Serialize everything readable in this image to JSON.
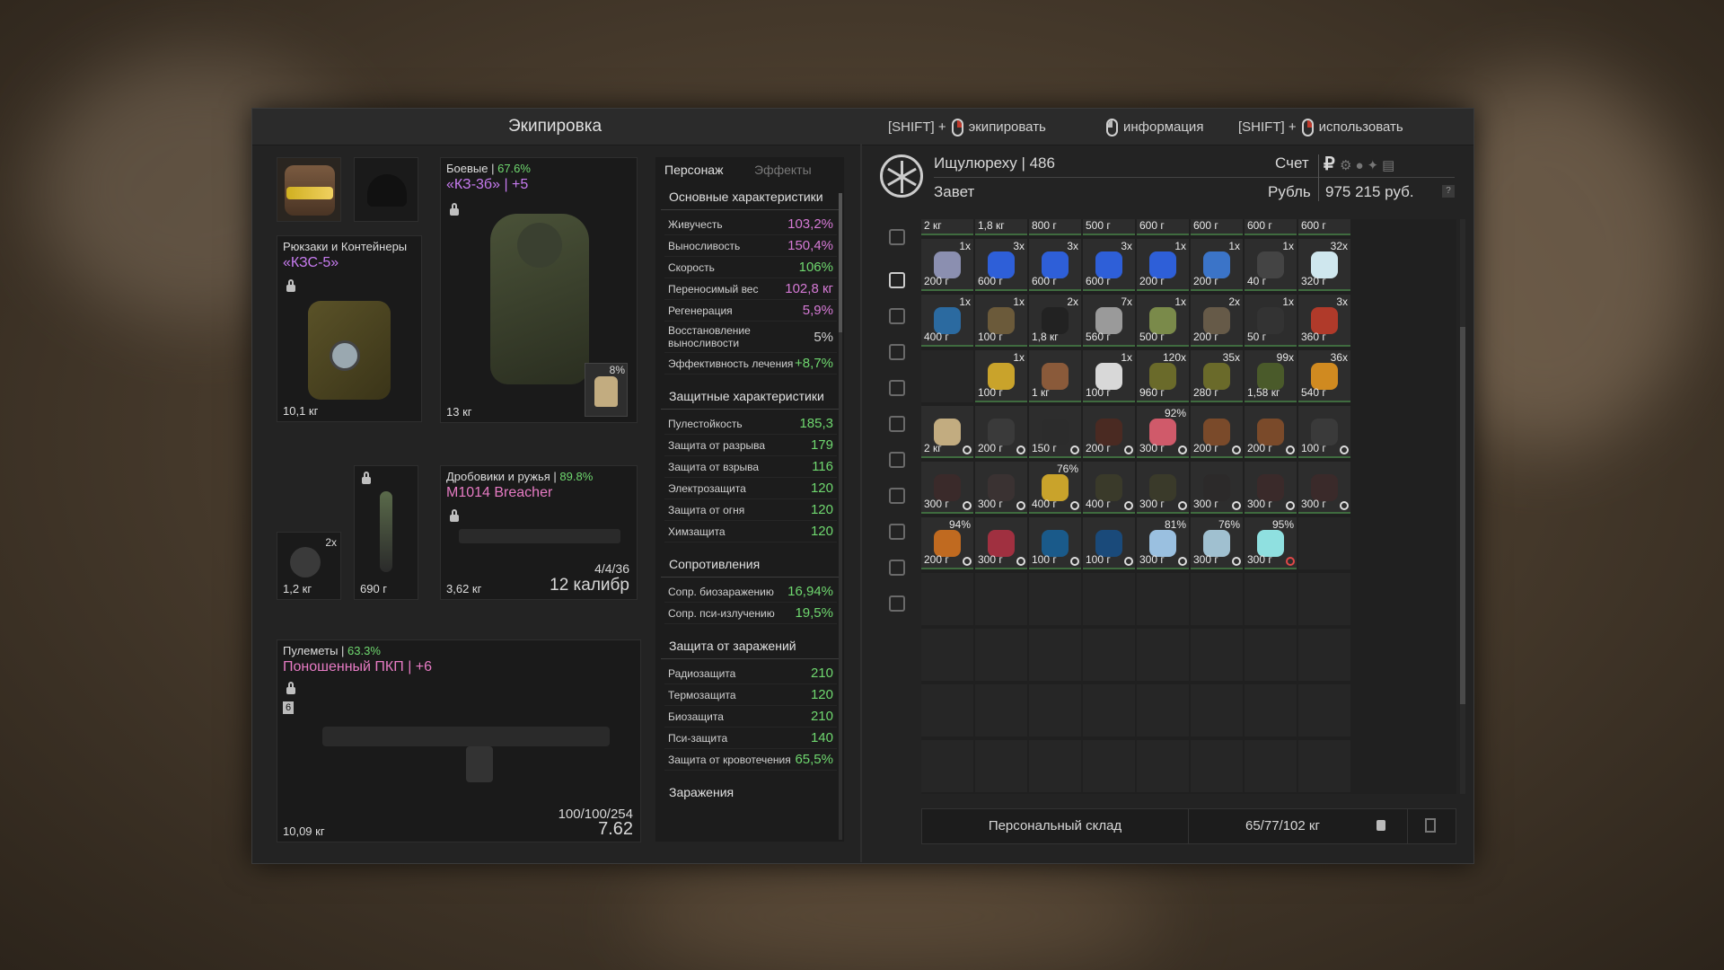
{
  "window": {
    "title": "Экипировка"
  },
  "hints": [
    {
      "prefix": "[SHIFT] +",
      "action": "экипировать"
    },
    {
      "prefix": "",
      "action": "информация"
    },
    {
      "prefix": "[SHIFT] +",
      "action": "использовать"
    }
  ],
  "equipment": {
    "armor": {
      "label": "Боевые",
      "pct": "67.6%",
      "name": "«КЗ-3б» | +5",
      "weight": "13 кг",
      "badge": "8%"
    },
    "backpack": {
      "label": "Рюкзаки и Контейнеры",
      "name": "«КЗС-5»",
      "weight": "10,1 кг"
    },
    "slot_small1": {
      "qty": "2x",
      "weight": "1,2 кг"
    },
    "slot_small2": {
      "weight": "690 г"
    },
    "shotgun": {
      "label": "Дробовики и ружья",
      "pct": "89.8%",
      "name": "M1014 Breacher",
      "weight": "3,62 кг",
      "ammo": "4/4/36",
      "caliber": "12 калибр"
    },
    "mg": {
      "label": "Пулеметы",
      "pct": "63.3%",
      "name": "Поношенный ПКП | +6",
      "weight": "10,09 кг",
      "ammo": "100/100/254",
      "caliber": "7.62",
      "slot_num": "6"
    }
  },
  "stats": {
    "tabs": [
      "Персонаж",
      "Эффекты"
    ],
    "main_title": "Основные характеристики",
    "main": [
      {
        "k": "Живучесть",
        "v": "103,2%",
        "c": "p"
      },
      {
        "k": "Выносливость",
        "v": "150,4%",
        "c": "p"
      },
      {
        "k": "Скорость",
        "v": "106%",
        "c": "g"
      },
      {
        "k": "Переносимый вес",
        "v": "102,8 кг",
        "c": "p"
      },
      {
        "k": "Регенерация",
        "v": "5,9%",
        "c": "p"
      },
      {
        "k": "Восстановление выносливости",
        "v": "5%",
        "c": ""
      },
      {
        "k": "Эффективность лечения",
        "v": "+8,7%",
        "c": "g"
      }
    ],
    "prot_title": "Защитные характеристики",
    "prot": [
      {
        "k": "Пулестойкость",
        "v": "185,3",
        "c": "g"
      },
      {
        "k": "Защита от разрыва",
        "v": "179",
        "c": "g"
      },
      {
        "k": "Защита от взрыва",
        "v": "116",
        "c": "g"
      },
      {
        "k": "Электрозащита",
        "v": "120",
        "c": "g"
      },
      {
        "k": "Защита от огня",
        "v": "120",
        "c": "g"
      },
      {
        "k": "Химзащита",
        "v": "120",
        "c": "g"
      }
    ],
    "res_title": "Сопротивления",
    "res": [
      {
        "k": "Сопр. биозаражению",
        "v": "16,94%",
        "c": "g"
      },
      {
        "k": "Сопр. пси-излучению",
        "v": "19,5%",
        "c": "g"
      }
    ],
    "inf_title": "Защита от заражений",
    "inf": [
      {
        "k": "Радиозащита",
        "v": "210",
        "c": "g"
      },
      {
        "k": "Термозащита",
        "v": "120",
        "c": "g"
      },
      {
        "k": "Биозащита",
        "v": "210",
        "c": "g"
      },
      {
        "k": "Пси-защита",
        "v": "140",
        "c": "g"
      },
      {
        "k": "Защита от кровотечения",
        "v": "65,5%",
        "c": "g"
      }
    ],
    "last_title": "Заражения"
  },
  "player": {
    "name": "Ищулюреху | 486",
    "faction": "Завет",
    "account_label": "Счет",
    "currency": "Рубль",
    "balance": "975 215 руб."
  },
  "inventory": {
    "top_row": [
      "2 кг",
      "1,8 кг",
      "800 г",
      "500 г",
      "600 г",
      "600 г",
      "600 г",
      "600 г"
    ],
    "items": [
      {
        "q": "1x",
        "p": "200 г",
        "c": "#8b8fb0"
      },
      {
        "q": "3x",
        "p": "600 г",
        "c": "#2e5fd8"
      },
      {
        "q": "3x",
        "p": "600 г",
        "c": "#2e5fd8"
      },
      {
        "q": "3x",
        "p": "600 г",
        "c": "#2e5fd8"
      },
      {
        "q": "1x",
        "p": "200 г",
        "c": "#2e5fd8"
      },
      {
        "q": "1x",
        "p": "200 г",
        "c": "#3b74c8"
      },
      {
        "q": "1x",
        "p": "40 г",
        "c": "#444"
      },
      {
        "q": "32x",
        "p": "320 г",
        "c": "#cfe7ee"
      },
      {
        "q": "1x",
        "p": "400 г",
        "c": "#2b6aa0"
      },
      {
        "q": "1x",
        "p": "100 г",
        "c": "#6b5a3a"
      },
      {
        "q": "2x",
        "p": "1,8 кг",
        "c": "#222"
      },
      {
        "q": "7x",
        "p": "560 г",
        "c": "#9a9a9a"
      },
      {
        "q": "1x",
        "p": "500 г",
        "c": "#7a8a4a"
      },
      {
        "q": "2x",
        "p": "200 г",
        "c": "#665a48"
      },
      {
        "q": "1x",
        "p": "50 г",
        "c": "#333"
      },
      {
        "q": "3x",
        "p": "360 г",
        "c": "#b03a2a"
      },
      {
        "q": "",
        "p": "",
        "c": ""
      },
      {
        "q": "1x",
        "p": "100 г",
        "c": "#c9a32b"
      },
      {
        "q": "",
        "p": "1 кг",
        "c": "#8a5a3a"
      },
      {
        "q": "1x",
        "p": "100 г",
        "c": "#d8d8d8"
      },
      {
        "q": "120x",
        "p": "960 г",
        "c": "#6a6a2a"
      },
      {
        "q": "35x",
        "p": "280 г",
        "c": "#6a6a2a"
      },
      {
        "q": "99x",
        "p": "1,58 кг",
        "c": "#4a5a2a"
      },
      {
        "q": "36x",
        "p": "540 г",
        "c": "#d08a20"
      },
      {
        "q": "",
        "p": "2 кг",
        "c": "#c2ac80"
      },
      {
        "q": "",
        "p": "200 г",
        "c": "#3a3a3a"
      },
      {
        "q": "",
        "p": "150 г",
        "c": "#2c2c2c"
      },
      {
        "q": "",
        "p": "200 г",
        "c": "#4a2a22"
      },
      {
        "q": "92%",
        "p": "300 г",
        "c": "#d05a6a"
      },
      {
        "q": "",
        "p": "200 г",
        "c": "#7a4a2a"
      },
      {
        "q": "",
        "p": "200 г",
        "c": "#7a4a2a"
      },
      {
        "q": "",
        "p": "100 г",
        "c": "#3a3a3a"
      },
      {
        "q": "",
        "p": "300 г",
        "c": "#3a2a2a"
      },
      {
        "q": "",
        "p": "300 г",
        "c": "#3a3232"
      },
      {
        "q": "76%",
        "p": "400 г",
        "c": "#c9a32b"
      },
      {
        "q": "",
        "p": "400 г",
        "c": "#3a3a2a"
      },
      {
        "q": "",
        "p": "300 г",
        "c": "#3a3a2a"
      },
      {
        "q": "",
        "p": "300 г",
        "c": "#2c2a2a"
      },
      {
        "q": "",
        "p": "300 г",
        "c": "#3a2a2a"
      },
      {
        "q": "",
        "p": "300 г",
        "c": "#3a2a2a"
      },
      {
        "q": "94%",
        "p": "200 г",
        "c": "#c06a20"
      },
      {
        "q": "",
        "p": "300 г",
        "c": "#a03040"
      },
      {
        "q": "",
        "p": "100 г",
        "c": "#1a5a8a"
      },
      {
        "q": "",
        "p": "100 г",
        "c": "#1a4a7a"
      },
      {
        "q": "81%",
        "p": "300 г",
        "c": "#9ac0e0"
      },
      {
        "q": "76%",
        "p": "300 г",
        "c": "#a0c0d0"
      },
      {
        "q": "95%",
        "p": "300 г",
        "c": "#8fe0e0"
      },
      {
        "q": "",
        "p": "",
        "c": ""
      }
    ],
    "footer_label": "Персональный склад",
    "footer_weight": "65/77/102 кг"
  }
}
